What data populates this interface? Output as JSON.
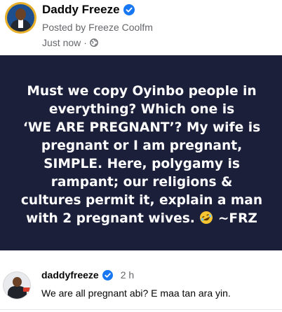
{
  "post": {
    "author": "Daddy Freeze",
    "posted_by": "Posted by Freeze Coolfm",
    "time": "Just now",
    "separator": "·",
    "privacy_icon": "globe-icon"
  },
  "image": {
    "line1": "Must we copy Oyinbo people in",
    "line2": "everything? Which one is",
    "line3": "‘WE ARE PREGNANT’? My wife is",
    "line4": "pregnant or I am pregnant,",
    "line5": "SIMPLE. Here, polygamy is",
    "line6": "rampant; our religions &",
    "line7": "cultures permit it, explain a man",
    "line8": "with 2 pregnant wives.",
    "emoji": "rolling-on-floor-laughing-emoji",
    "signature": "~FRZ",
    "background": "#1b1f3a"
  },
  "comment": {
    "username": "daddyfreeze",
    "time": "2 h",
    "text": "We are all pregnant abi? E maa tan ara yin."
  },
  "colors": {
    "verified": "#1877f2",
    "muted": "#65676b"
  }
}
